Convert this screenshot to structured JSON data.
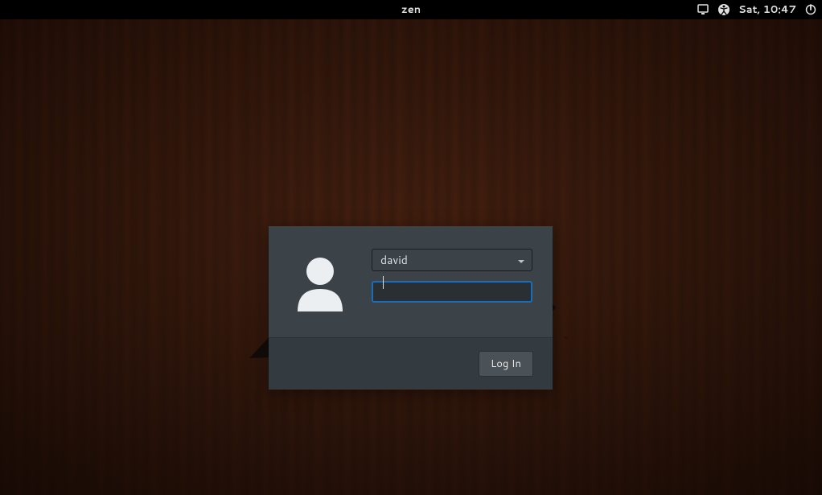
{
  "top_bar": {
    "hostname": "zen",
    "datetime": "Sat, 10:47"
  },
  "login": {
    "username": "david",
    "password_value": "",
    "login_button_label": "Log In"
  }
}
